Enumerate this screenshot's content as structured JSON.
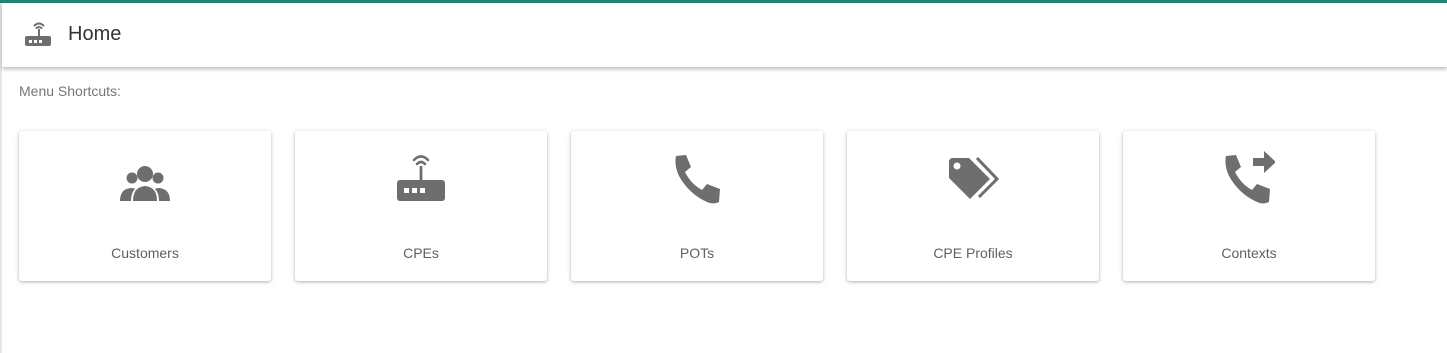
{
  "header": {
    "title": "Home",
    "icon": "router-icon"
  },
  "main": {
    "shortcuts_label": "Menu Shortcuts:",
    "cards": [
      {
        "label": "Customers",
        "icon": "customers-icon"
      },
      {
        "label": "CPEs",
        "icon": "router-icon"
      },
      {
        "label": "POTs",
        "icon": "phone-icon"
      },
      {
        "label": "CPE Profiles",
        "icon": "tags-icon"
      },
      {
        "label": "Contexts",
        "icon": "phone-forward-icon"
      }
    ]
  },
  "colors": {
    "accent": "#0f8c7a",
    "icon": "#6e6e6e",
    "label": "#616161",
    "title": "#333333"
  }
}
